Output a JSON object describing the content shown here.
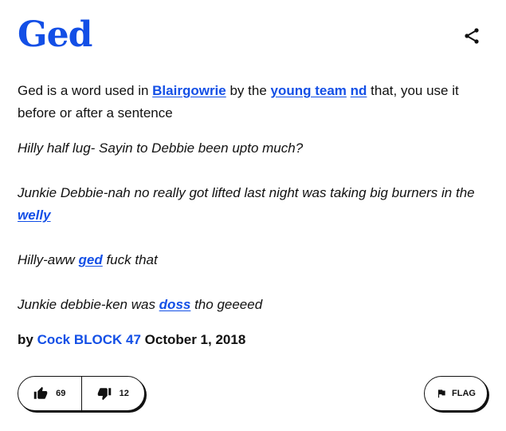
{
  "entry": {
    "word": "Ged",
    "meaning": {
      "t1": "Ged is a word used in ",
      "link1": "Blairgowrie",
      "t2": " by the ",
      "link2": "young team",
      "t3": " ",
      "link3": "nd",
      "t4": " that, you use it before or after a sentence"
    },
    "example": {
      "line1": "Hilly half lug- Sayin to Debbie been upto much?",
      "line2_text": "Junkie Debbie-nah no really got lifted last night was taking big burners in the ",
      "line2_link": "welly",
      "line3_pre": "Hilly-aww ",
      "line3_link": "ged",
      "line3_post": " fuck that",
      "line4_pre": "Junkie debbie-ken was ",
      "line4_link": "doss",
      "line4_post": " tho geeeed"
    },
    "byline": {
      "prefix": "by ",
      "author": "Cock BLOCK 47",
      "date": " October 1, 2018"
    }
  },
  "actions": {
    "upvotes": "69",
    "downvotes": "12",
    "flag_label": "FLAG"
  },
  "icons": {
    "share": "share-icon",
    "thumbs_up": "thumbs-up-icon",
    "thumbs_down": "thumbs-down-icon",
    "flag": "flag-icon"
  },
  "colors": {
    "accent": "#134fe6",
    "text": "#111111"
  }
}
